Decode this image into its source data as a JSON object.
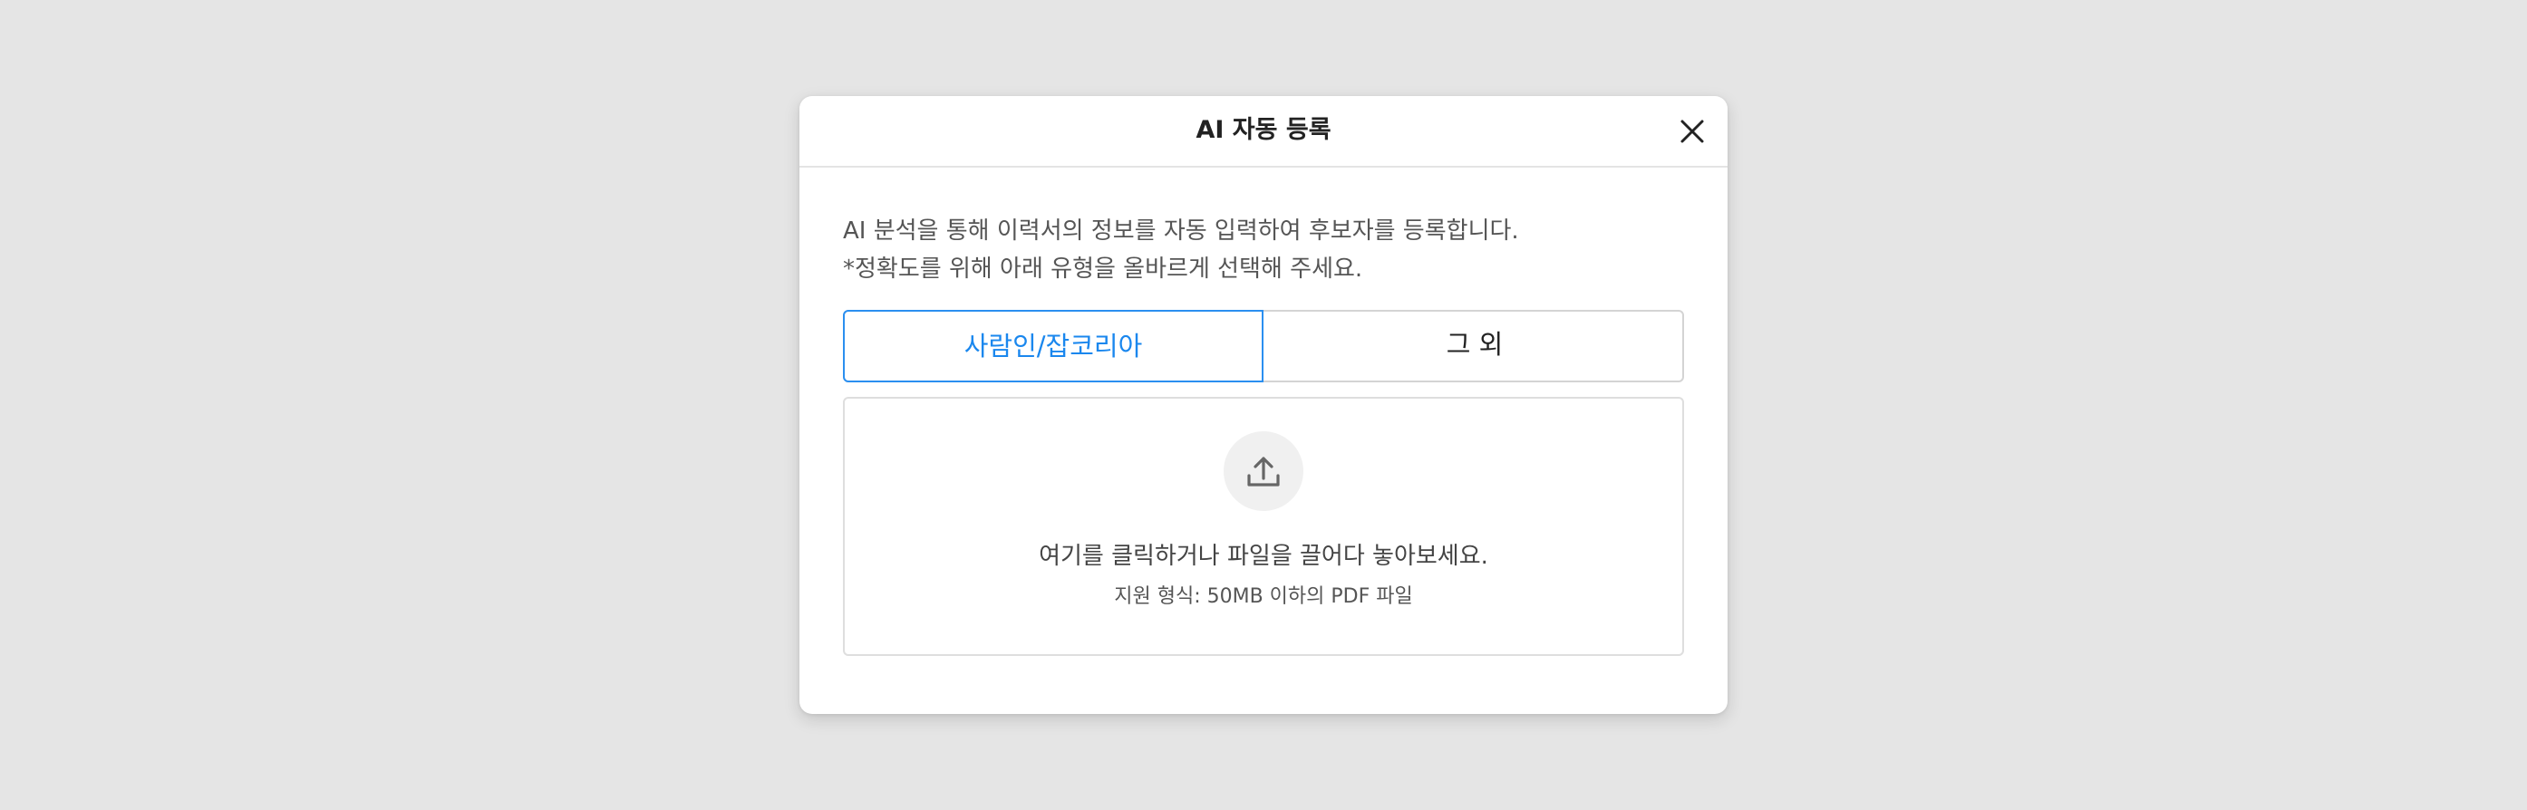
{
  "modal": {
    "title": "AI 자동 등록",
    "close_icon": "close-icon"
  },
  "description": {
    "line1": "AI 분석을 통해 이력서의 정보를 자동 입력하여 후보자를 등록합니다.",
    "line2": "*정확도를 위해 아래 유형을 올바르게 선택해 주세요."
  },
  "tabs": [
    {
      "label": "사람인/잡코리아",
      "selected": true
    },
    {
      "label": "그 외",
      "selected": false
    }
  ],
  "dropzone": {
    "icon": "upload-icon",
    "main_text": "여기를 클릭하거나 파일을 끌어다 놓아보세요.",
    "sub_text": "지원 형식: 50MB 이하의 PDF 파일"
  },
  "colors": {
    "accent": "#1a87ee",
    "background": "#e5e5e5",
    "modal": "#ffffff"
  }
}
